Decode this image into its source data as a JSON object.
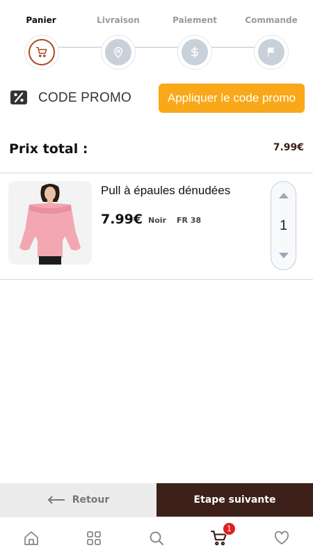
{
  "checkout_steps": [
    {
      "label": "Panier",
      "icon": "cart-icon",
      "active": true
    },
    {
      "label": "Livraison",
      "icon": "location-pin-icon",
      "active": false
    },
    {
      "label": "Paiement",
      "icon": "dollar-icon",
      "active": false
    },
    {
      "label": "Commande",
      "icon": "flag-icon",
      "active": false
    }
  ],
  "promo": {
    "label": "CODE PROMO",
    "button_label": "Appliquer le code promo",
    "icon": "coupon-icon"
  },
  "total": {
    "label": "Prix total :",
    "value": "7.99€"
  },
  "cart_items": [
    {
      "name": "Pull à épaules dénudées",
      "price": "7.99€",
      "color": "Noir",
      "size": "FR 38",
      "quantity": "1"
    }
  ],
  "actions": {
    "back_label": "Retour",
    "next_label": "Etape suivante"
  },
  "tabbar": {
    "items": [
      "home-icon",
      "grid-icon",
      "search-icon",
      "cart-icon",
      "heart-icon"
    ],
    "cart_badge": "1"
  },
  "colors": {
    "accent_orange": "#f9a81a",
    "brand_brown": "#3c2019",
    "active_step": "#b0461e",
    "inactive_step": "#c8d1d9",
    "badge_red": "#e02020"
  }
}
